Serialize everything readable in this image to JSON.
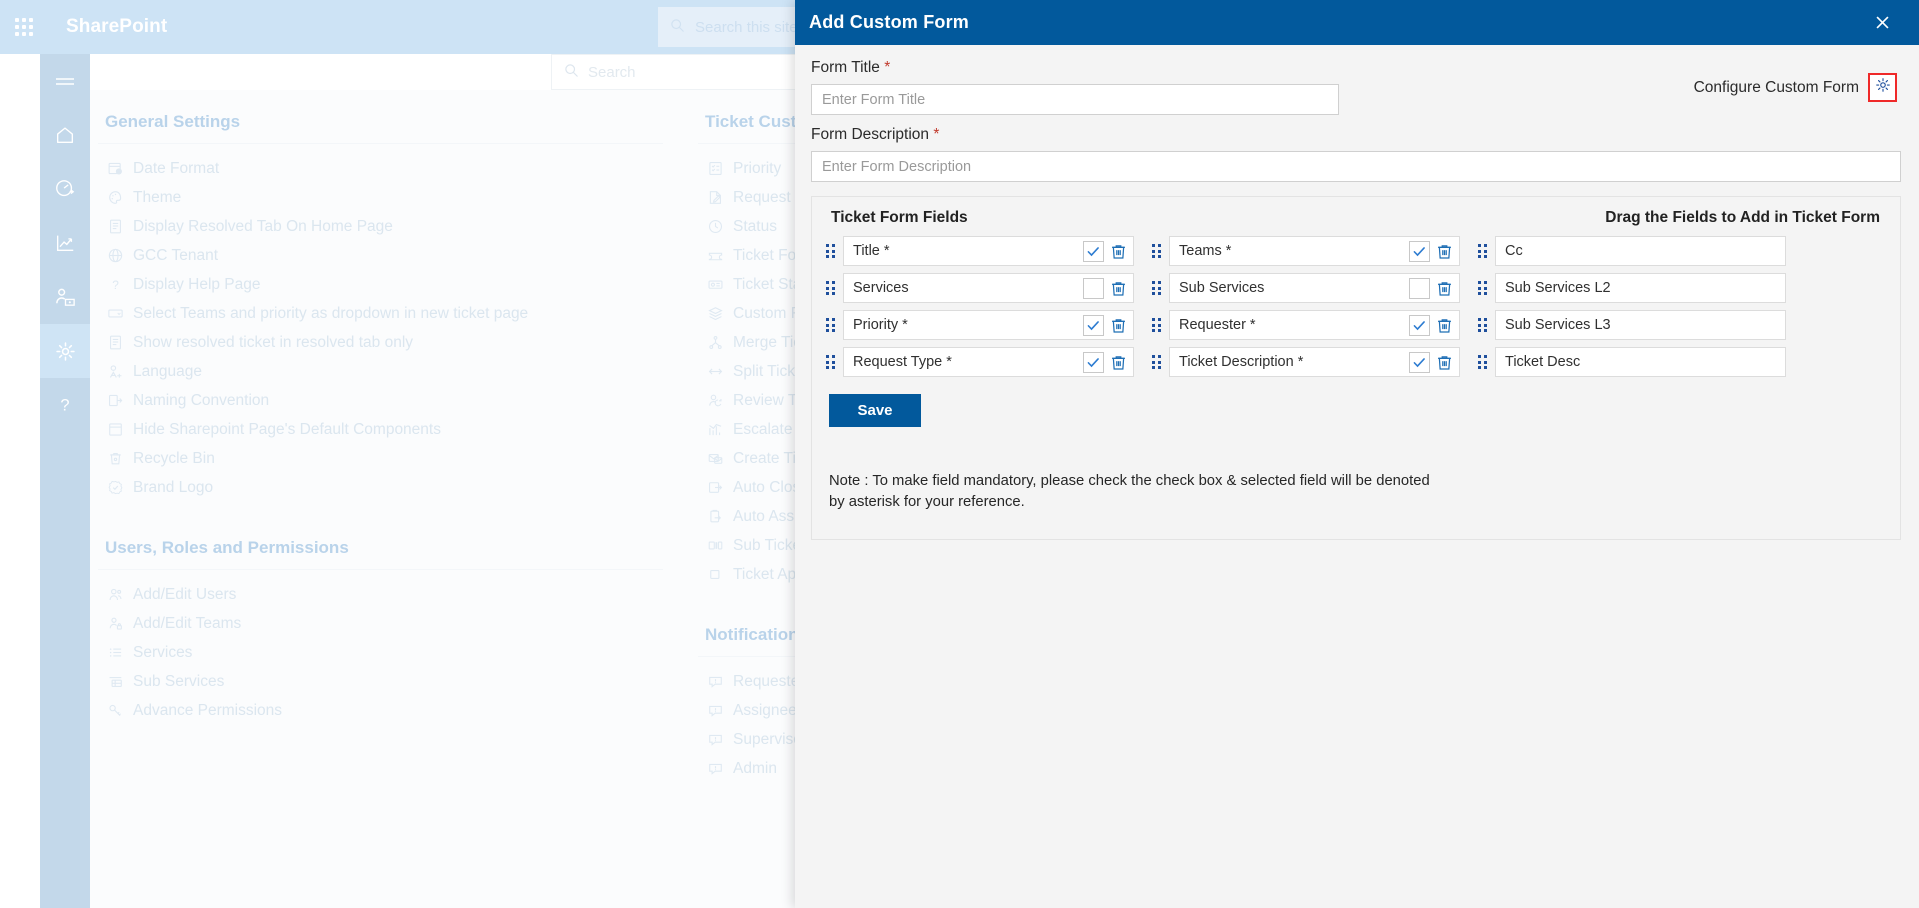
{
  "suite_bar": {
    "waffle_icon": "waffle-grid-icon",
    "brand": "SharePoint",
    "search_placeholder": "Search this site"
  },
  "site_bar": {
    "search_placeholder": "Search"
  },
  "rail": {
    "items": [
      {
        "icon": "hamburger-menu-icon",
        "name": "menu-toggle",
        "active": false
      },
      {
        "icon": "home-icon",
        "name": "home",
        "active": false
      },
      {
        "icon": "dashboard-gauge-icon",
        "name": "dashboard",
        "active": false
      },
      {
        "icon": "chart-trend-icon",
        "name": "reports",
        "active": false
      },
      {
        "icon": "user-settings-icon",
        "name": "users",
        "active": false
      },
      {
        "icon": "gear-icon",
        "name": "settings",
        "active": true
      },
      {
        "icon": "question-mark-icon",
        "name": "help",
        "active": false
      }
    ]
  },
  "settings": {
    "columns": [
      {
        "sections": [
          {
            "title": "General Settings",
            "items": [
              {
                "label": "Date Format",
                "icon": "calendar-clock-icon"
              },
              {
                "label": "Theme",
                "icon": "palette-icon"
              },
              {
                "label": "Display Resolved Tab On Home Page",
                "icon": "document-icon"
              },
              {
                "label": "GCC Tenant",
                "icon": "globe-icon"
              },
              {
                "label": "Display Help Page",
                "icon": "question-mark-icon"
              },
              {
                "label": "Select Teams and priority as dropdown in new ticket page",
                "icon": "dropdown-icon"
              },
              {
                "label": "Show resolved ticket in resolved tab only",
                "icon": "document-icon"
              },
              {
                "label": "Language",
                "icon": "language-icon"
              },
              {
                "label": "Naming Convention",
                "icon": "naming-panel-icon"
              },
              {
                "label": "Hide Sharepoint Page's Default Components",
                "icon": "window-icon"
              },
              {
                "label": "Recycle Bin",
                "icon": "recycle-bin-icon"
              },
              {
                "label": "Brand Logo",
                "icon": "badge-check-icon"
              }
            ]
          },
          {
            "title": "Users, Roles and Permissions",
            "items": [
              {
                "label": "Add/Edit Users",
                "icon": "people-icon"
              },
              {
                "label": "Add/Edit Teams",
                "icon": "team-lock-icon"
              },
              {
                "label": "Services",
                "icon": "list-bullet-icon"
              },
              {
                "label": "Sub Services",
                "icon": "list-indent-icon"
              },
              {
                "label": "Advance Permissions",
                "icon": "key-icon"
              }
            ]
          }
        ]
      },
      {
        "sections": [
          {
            "title": "Ticket Customization",
            "items": [
              {
                "label": "Priority",
                "icon": "priority-list-icon"
              },
              {
                "label": "Request Type",
                "icon": "edit-document-icon"
              },
              {
                "label": "Status",
                "icon": "clock-check-icon"
              },
              {
                "label": "Ticket Form",
                "icon": "ticket-icon"
              },
              {
                "label": "Ticket Status",
                "icon": "ticket-status-icon"
              },
              {
                "label": "Custom Form",
                "icon": "layers-icon"
              },
              {
                "label": "Merge Ticket",
                "icon": "merge-icon"
              },
              {
                "label": "Split Ticket",
                "icon": "split-arrows-icon"
              },
              {
                "label": "Review Ticket",
                "icon": "review-user-icon"
              },
              {
                "label": "Escalate Ticket",
                "icon": "escalate-chart-icon"
              },
              {
                "label": "Create Ticket",
                "icon": "create-mail-icon"
              },
              {
                "label": "Auto Close Ticket",
                "icon": "auto-close-icon"
              },
              {
                "label": "Auto Assign Ticket",
                "icon": "clipboard-arrow-icon"
              },
              {
                "label": "Sub Ticket",
                "icon": "sub-ticket-icon"
              },
              {
                "label": "Ticket Approval",
                "icon": "square-icon"
              }
            ]
          },
          {
            "title": "Notifications",
            "items": [
              {
                "label": "Requester",
                "icon": "comment-alert-icon"
              },
              {
                "label": "Assignee",
                "icon": "comment-alert-icon"
              },
              {
                "label": "Supervisor",
                "icon": "comment-alert-icon"
              },
              {
                "label": "Admin",
                "icon": "comment-alert-icon"
              }
            ]
          }
        ]
      }
    ]
  },
  "modal": {
    "title": "Add Custom Form",
    "close_icon": "close-icon",
    "form_title_label": "Form Title",
    "form_title_value": "",
    "form_title_placeholder": "Enter Form Title",
    "form_desc_label": "Form Description",
    "form_desc_value": "",
    "form_desc_placeholder": "Enter Form Description",
    "required_marker": "*",
    "configure_label": "Configure Custom Form",
    "configure_icon": "gear-icon",
    "highlight_color": "#ef2929",
    "accent_color": "#02599c",
    "panel": {
      "heading_left": "Ticket Form Fields",
      "heading_right": "Drag the Fields to Add in Ticket Form",
      "rows": [
        {
          "left": {
            "label": "Title *",
            "mandatory": true,
            "has_controls": true
          },
          "middle": {
            "label": "Teams *",
            "mandatory": true,
            "has_controls": true
          },
          "right": {
            "label": "Cc",
            "mandatory": false,
            "has_controls": false
          }
        },
        {
          "left": {
            "label": "Services",
            "mandatory": false,
            "has_controls": true
          },
          "middle": {
            "label": "Sub Services",
            "mandatory": false,
            "has_controls": true
          },
          "right": {
            "label": "Sub Services L2",
            "mandatory": false,
            "has_controls": false
          }
        },
        {
          "left": {
            "label": "Priority *",
            "mandatory": true,
            "has_controls": true
          },
          "middle": {
            "label": "Requester *",
            "mandatory": true,
            "has_controls": true
          },
          "right": {
            "label": "Sub Services L3",
            "mandatory": false,
            "has_controls": false
          }
        },
        {
          "left": {
            "label": "Request Type *",
            "mandatory": true,
            "has_controls": true
          },
          "middle": {
            "label": "Ticket Description *",
            "mandatory": true,
            "has_controls": true
          },
          "right": {
            "label": "Ticket Desc",
            "mandatory": false,
            "has_controls": false
          }
        }
      ]
    },
    "save_label": "Save",
    "note": "Note : To make field mandatory, please check the check box & selected field will be denoted by asterisk for your reference."
  }
}
